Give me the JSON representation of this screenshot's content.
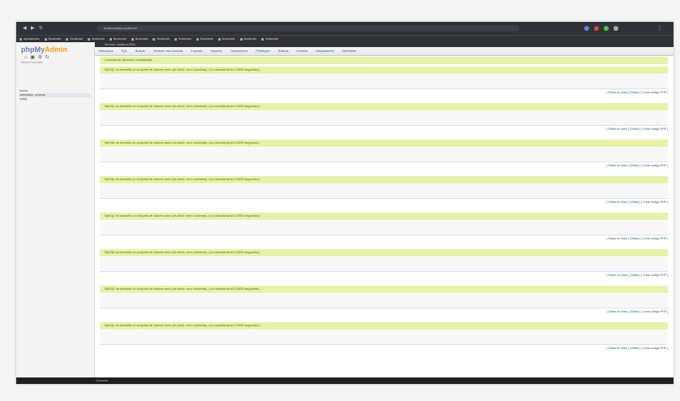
{
  "browser": {
    "url": "localhost/phpmyadmin/",
    "bookmarks": [
      "Aplicaciones",
      "Bookmark",
      "Bookmark",
      "Bookmark",
      "Bookmark",
      "Bookmark",
      "Bookmark",
      "Bookmark",
      "Bookmark",
      "Bookmark",
      "Bookmark",
      "Bookmark"
    ]
  },
  "sidebar": {
    "logo_main": "phpMy",
    "logo_accent": "Admin",
    "recent_label": "Recent  Favorites",
    "tree": [
      "Nueva",
      "information_schema",
      "mysql",
      "",
      "",
      "",
      "",
      "",
      "",
      ""
    ]
  },
  "main": {
    "breadcrumb": "Servidor: localhost:3306",
    "tabs": [
      "Estructura",
      "SQL",
      "Buscar",
      "Generar una consulta",
      "Exportar",
      "Importar",
      "Operaciones",
      "Privilegios",
      "Rutinas",
      "Eventos",
      "Disparadores",
      "Diseñador"
    ],
    "notice": "Consulta de ejecución completada. ",
    "results": [
      {
        "success": "MySQL ha devuelto un conjunto de valores vacío (es decir: cero columnas). (La consulta tardó 0.0000 segundos.)",
        "sql": "",
        "links": "[ Editar en línea ] [ Editar ] [ Crear código PHP ]"
      },
      {
        "success": "MySQL ha devuelto un conjunto de valores vacío (es decir: cero columnas). (La consulta tardó 0.0000 segundos.)",
        "sql": "",
        "links": "[ Editar en línea ] [ Editar ] [ Crear código PHP ]"
      },
      {
        "success": "MySQL ha devuelto un conjunto de valores vacío (es decir: cero columnas). (La consulta tardó 0.0000 segundos.)",
        "sql": "",
        "links": "[ Editar en línea ] [ Editar ] [ Crear código PHP ]"
      },
      {
        "success": "MySQL ha devuelto un conjunto de valores vacío (es decir: cero columnas). (La consulta tardó 0.0000 segundos.)",
        "sql": "",
        "links": "[ Editar en línea ] [ Editar ] [ Crear código PHP ]"
      },
      {
        "success": "MySQL ha devuelto un conjunto de valores vacío (es decir: cero columnas). (La consulta tardó 0.0000 segundos.)",
        "sql": "",
        "links": "[ Editar en línea ] [ Editar ] [ Crear código PHP ]"
      },
      {
        "success": "MySQL ha devuelto un conjunto de valores vacío (es decir: cero columnas). (La consulta tardó 0.0000 segundos.)",
        "sql": "",
        "links": "[ Editar en línea ] [ Editar ] [ Crear código PHP ]"
      },
      {
        "success": "MySQL ha devuelto un conjunto de valores vacío (es decir: cero columnas). (La consulta tardó 0.0000 segundos.)",
        "sql": "",
        "links": "[ Editar en línea ] [ Editar ] [ Crear código PHP ]"
      },
      {
        "success": "MySQL ha devuelto un conjunto de valores vacío (es decir: cero columnas). (La consulta tardó 0.0000 segundos.)",
        "sql": "",
        "links": "[ Editar en línea ] [ Editar ] [ Crear código PHP ]"
      }
    ],
    "console_label": "Consola"
  },
  "colors": {
    "success_bg": "#e5f2a8",
    "browser_chrome": "#2f3237",
    "link": "#235a81"
  }
}
